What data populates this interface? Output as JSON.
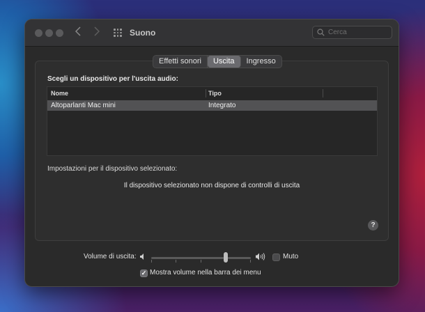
{
  "window": {
    "title": "Suono",
    "search_placeholder": "Cerca"
  },
  "tabs": [
    {
      "label": "Effetti sonori",
      "active": false
    },
    {
      "label": "Uscita",
      "active": true
    },
    {
      "label": "Ingresso",
      "active": false
    }
  ],
  "output": {
    "heading": "Scegli un dispositivo per l'uscita audio:",
    "columns": [
      "Nome",
      "Tipo"
    ],
    "rows": [
      {
        "name": "Altoparlanti Mac mini",
        "type": "Integrato",
        "selected": true
      }
    ],
    "settings_label": "Impostazioni per il dispositivo selezionato:",
    "no_controls_text": "Il dispositivo selezionato non dispone di controlli di uscita",
    "help_label": "?"
  },
  "volume": {
    "label": "Volume di uscita:",
    "level": 0.75,
    "mute_label": "Muto",
    "mute_checked": false,
    "show_in_menu_label": "Mostra volume nella barra dei menu",
    "show_in_menu_checked": true
  },
  "icons": {
    "back": "chevron-left-icon",
    "forward": "chevron-right-icon",
    "grid": "grid-icon",
    "search": "search-icon",
    "speaker_low": "speaker-low-icon",
    "speaker_high": "speaker-high-icon",
    "help": "help-icon"
  },
  "colors": {
    "window_bg": "#2a2a2a",
    "selected_row": "#525254",
    "active_tab": "#6a6a6e"
  }
}
